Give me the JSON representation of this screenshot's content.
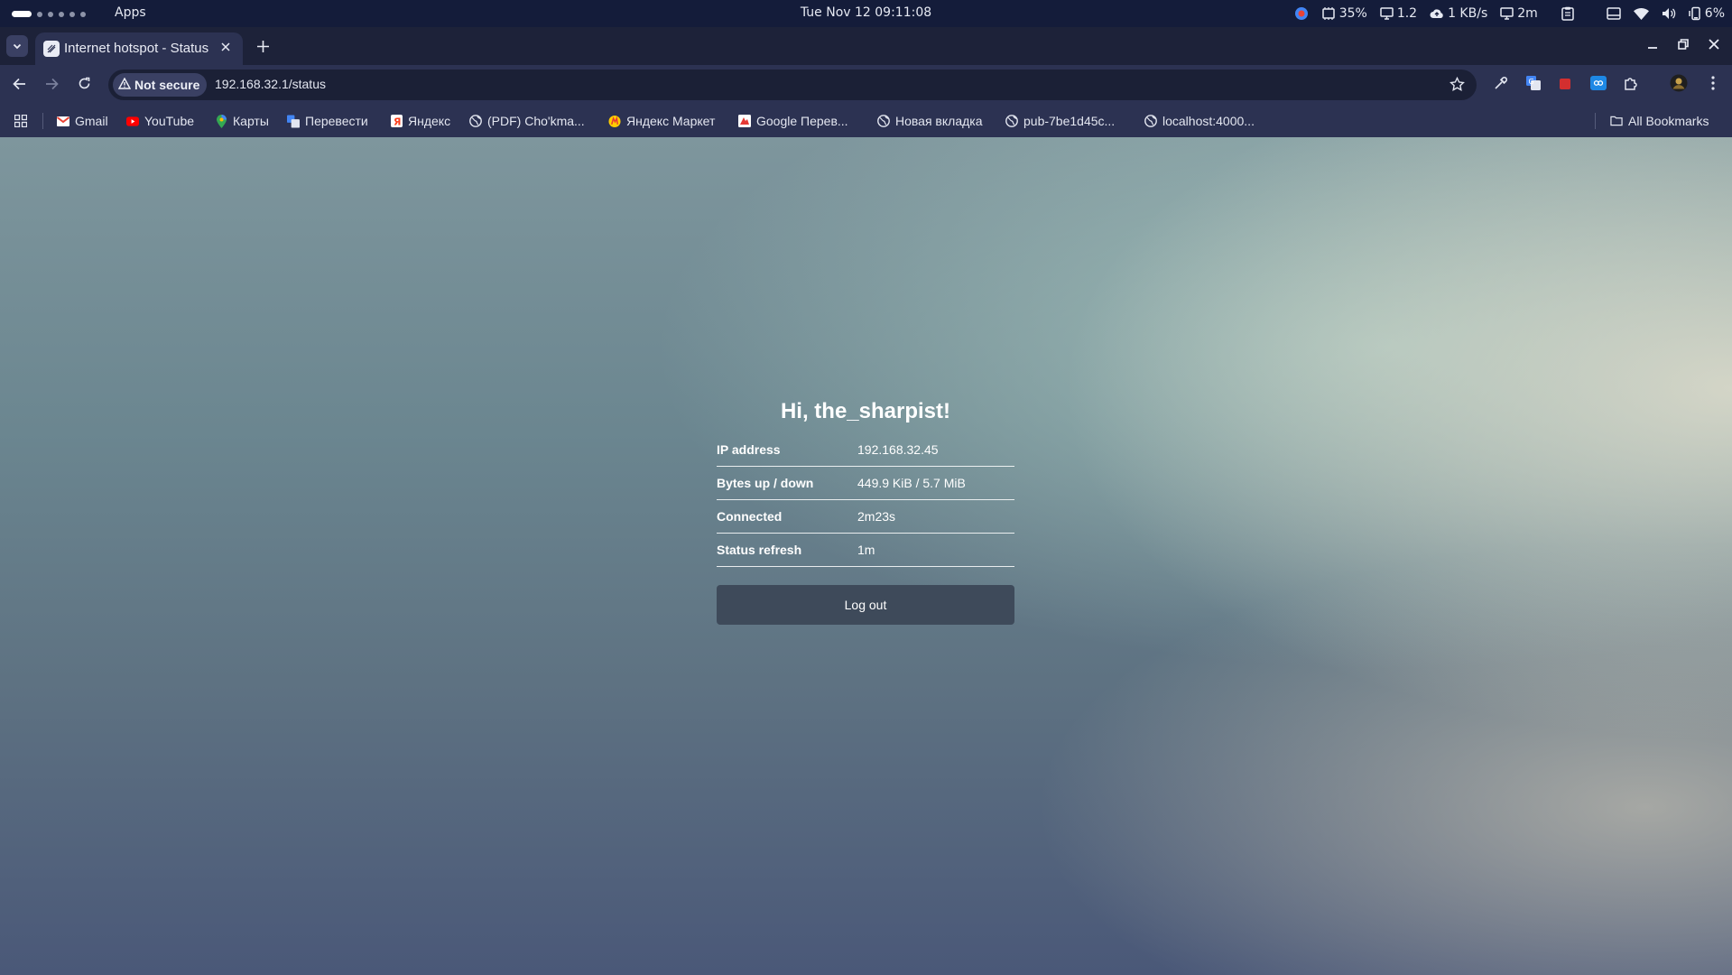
{
  "system_bar": {
    "apps_label": "Apps",
    "clock": "Tue Nov 12  09:11:08",
    "cpu": "35%",
    "load": "1.2",
    "net": "1 KB/s",
    "uptime": "2m",
    "battery": "6%"
  },
  "browser": {
    "tab_title": "Internet hotspot - Status",
    "security_label": "Not secure",
    "url": "192.168.32.1/status"
  },
  "bookmarks": {
    "items": [
      {
        "label": "Gmail",
        "icon": "gmail-icon"
      },
      {
        "label": "YouTube",
        "icon": "youtube-icon"
      },
      {
        "label": "Карты",
        "icon": "maps-icon"
      },
      {
        "label": "Перевести",
        "icon": "translate-icon"
      },
      {
        "label": "Яндекс",
        "icon": "yandex-icon"
      },
      {
        "label": "(PDF) Cho'kma...",
        "icon": "globe-icon"
      },
      {
        "label": "Яндекс Маркет",
        "icon": "yandex-market-icon"
      },
      {
        "label": "Google Перев...",
        "icon": "google-translate-icon"
      },
      {
        "label": "Новая вкладка",
        "icon": "globe-icon"
      },
      {
        "label": "pub-7be1d45c...",
        "icon": "globe-icon"
      },
      {
        "label": "localhost:4000...",
        "icon": "globe-icon"
      }
    ],
    "all_bookmarks": "All Bookmarks"
  },
  "status": {
    "greeting": "Hi, the_sharpist!",
    "rows": [
      {
        "label": "IP address",
        "value": "192.168.32.45"
      },
      {
        "label": "Bytes up / down",
        "value": "449.9 KiB / 5.7 MiB"
      },
      {
        "label": "Connected",
        "value": "2m23s"
      },
      {
        "label": "Status refresh",
        "value": "1m"
      }
    ],
    "logout_label": "Log out"
  },
  "colors": {
    "system_bar": "#141c3a",
    "browser_chrome": "#2c3252",
    "button": "#3e4a5a"
  }
}
